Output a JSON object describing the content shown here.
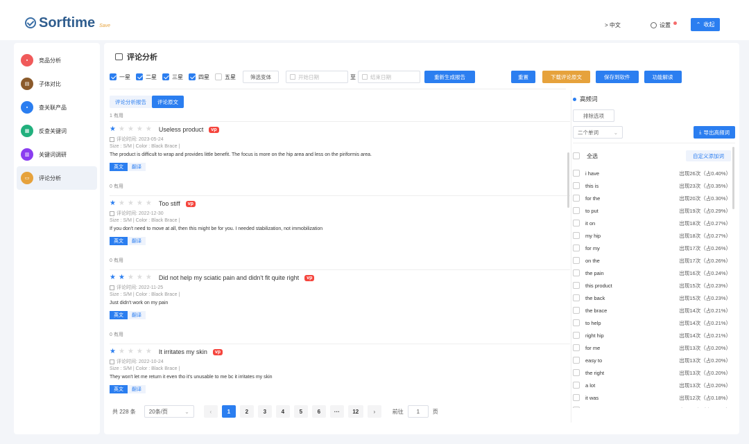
{
  "header": {
    "logo_text": "Sorftime",
    "logo_sub": "Save",
    "lang": "> 中文",
    "settings": "设置",
    "collapse": "收起"
  },
  "sidebar": {
    "items": [
      {
        "label": "竞品分析",
        "color": "#f05a5a",
        "icon": "flag-icon"
      },
      {
        "label": "子体对比",
        "color": "#8b5a2b",
        "icon": "compare-icon"
      },
      {
        "label": "查关联产品",
        "color": "#2b7ef0",
        "icon": "link-icon"
      },
      {
        "label": "反查关键词",
        "color": "#22b07d",
        "icon": "reverse-search-icon"
      },
      {
        "label": "关键词调研",
        "color": "#8a3df0",
        "icon": "keyword-icon"
      },
      {
        "label": "评论分析",
        "color": "#e6a23c",
        "icon": "comment-icon"
      }
    ],
    "active_index": 5
  },
  "main": {
    "title": "评论分析",
    "star_filters": [
      {
        "label": "一星",
        "checked": true
      },
      {
        "label": "二星",
        "checked": true
      },
      {
        "label": "三星",
        "checked": true
      },
      {
        "label": "四星",
        "checked": true
      },
      {
        "label": "五星",
        "checked": false
      }
    ],
    "filter_variant": "筛选变体",
    "start_date_placeholder": "开始日期",
    "date_sep": "至",
    "end_date_placeholder": "结束日期",
    "regenerate": "重新生成报告",
    "reset": "重置",
    "download": "下载评论原文",
    "save_to_software": "保存到软件",
    "function_explain": "功能解读",
    "accent": "#2b7ef0",
    "orange": "#e6a23c"
  },
  "tabs": [
    {
      "label": "评论分析报告",
      "active": false
    },
    {
      "label": "评论原文",
      "active": true
    }
  ],
  "top_useful": "1 有用",
  "reviews": [
    {
      "stars": 1,
      "title": "Useless product",
      "badge": "vp",
      "time": "评论时间: 2023-05-24",
      "attr": "Size : S/M  |  Color : Black Brace  |",
      "body": "The product is difficult to wrap and provides little benefit. The focus is more on the hip area and less on the piriformis area.",
      "lang": "英文",
      "translate": "翻译",
      "useful": "0 有用"
    },
    {
      "stars": 1,
      "title": "Too stiff",
      "badge": "vp",
      "time": "评论时间: 2022-12-30",
      "attr": "Size : S/M  |  Color : Black Brace  |",
      "body": "If you don't need to move at all, then this might be for you. I needed stabilization, not immobilization",
      "lang": "英文",
      "translate": "翻译",
      "useful": "0 有用"
    },
    {
      "stars": 2,
      "title": "Did not help my sciatic pain and didn't fit quite right",
      "badge": "vp",
      "time": "评论时间: 2022-11-25",
      "attr": "Size : S/M  |  Color : Black Brace  |",
      "body": "Just didn't work on my pain",
      "lang": "英文",
      "translate": "翻译",
      "useful": "0 有用"
    },
    {
      "stars": 1,
      "title": "It irritates my skin",
      "badge": "vp",
      "time": "评论时间: 2022-10-24",
      "attr": "Size : S/M  |  Color : Black Brace  |",
      "body": "They won't let me return it even tho it's unusable to me bc it irritates my skin",
      "lang": "英文",
      "translate": "翻译",
      "useful": ""
    }
  ],
  "pager": {
    "total": "共 228 条",
    "page_size": "20条/页",
    "pages": [
      "1",
      "2",
      "3",
      "4",
      "5",
      "6",
      "···",
      "12"
    ],
    "current": "1",
    "goto_label": "前往",
    "goto_value": "1",
    "page_unit": "页"
  },
  "right": {
    "title": "高频词",
    "exclude": "排除选项",
    "select_value": "二个单词",
    "export": "导出高频词",
    "select_all": "全选",
    "custom_add": "自定义添加词",
    "words": [
      {
        "w": "i have",
        "c": "出现26次（占0.40%）"
      },
      {
        "w": "this is",
        "c": "出现23次（占0.35%）"
      },
      {
        "w": "for the",
        "c": "出现20次（占0.30%）"
      },
      {
        "w": "to put",
        "c": "出现19次（占0.29%）"
      },
      {
        "w": "it on",
        "c": "出现18次（占0.27%）"
      },
      {
        "w": "my hip",
        "c": "出现18次（占0.27%）"
      },
      {
        "w": "for my",
        "c": "出现17次（占0.26%）"
      },
      {
        "w": "on the",
        "c": "出现17次（占0.26%）"
      },
      {
        "w": "the pain",
        "c": "出现16次（占0.24%）"
      },
      {
        "w": "this product",
        "c": "出现15次（占0.23%）"
      },
      {
        "w": "the back",
        "c": "出现15次（占0.23%）"
      },
      {
        "w": "the brace",
        "c": "出现14次（占0.21%）"
      },
      {
        "w": "to help",
        "c": "出现14次（占0.21%）"
      },
      {
        "w": "right hip",
        "c": "出现14次（占0.21%）"
      },
      {
        "w": "for me",
        "c": "出现13次（占0.20%）"
      },
      {
        "w": "easy to",
        "c": "出现13次（占0.20%）"
      },
      {
        "w": "the right",
        "c": "出现13次（占0.20%）"
      },
      {
        "w": "a lot",
        "c": "出现13次（占0.20%）"
      },
      {
        "w": "it was",
        "c": "出现12次（占0.18%）"
      },
      {
        "w": "to the",
        "c": "出现12次（占0.18%）"
      }
    ]
  }
}
